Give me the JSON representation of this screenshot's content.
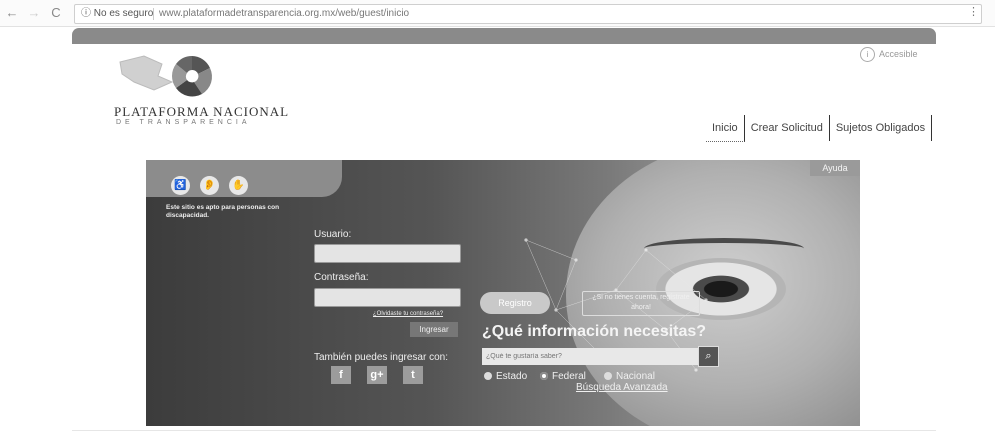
{
  "browser": {
    "back_glyph": "←",
    "forward_glyph": "→",
    "reload_glyph": "C",
    "security_label": "ⓘ No es seguro",
    "url": "www.plataformadetransparencia.org.mx/web/guest/inicio",
    "menu_glyph": "⋮"
  },
  "site": {
    "logo_title": "PLATAFORMA NACIONAL",
    "logo_subtitle": "DE TRANSPARENCIA",
    "accessibility_link": "Accesible",
    "accessibility_link_icon": "person-circle-icon",
    "nav": [
      {
        "label": "Inicio"
      },
      {
        "label": "Crear Solicitud"
      },
      {
        "label": "Sujetos Obligados"
      }
    ]
  },
  "hero": {
    "help_label": "Ayuda",
    "accessibility_icons": [
      "wheelchair-icon",
      "ear-icon",
      "sign-language-icon"
    ],
    "accessibility_glyphs": [
      "♿",
      "👂",
      "✋"
    ],
    "accessibility_text": "Este sitio es apto para personas con discapacidad.",
    "login": {
      "user_label": "Usuario:",
      "user_value": "",
      "password_label": "Contraseña:",
      "password_value": "",
      "forgot_label": "¿Olvidaste tu contraseña?",
      "submit_label": "Ingresar",
      "social_label": "También puedes ingresar con:",
      "social": [
        {
          "icon": "facebook-icon",
          "glyph": "f"
        },
        {
          "icon": "google-plus-icon",
          "glyph": "g+"
        },
        {
          "icon": "twitter-icon",
          "glyph": "t"
        }
      ]
    },
    "register_label": "Registro",
    "no_account_text": "¿Si no tienes cuenta, regístrate ahora!",
    "question": "¿Qué información necesitas?",
    "search_placeholder": "¿Qué te gustaría saber?",
    "search_icon": "search-icon",
    "scope_options": [
      {
        "label": "Estado",
        "selected": false
      },
      {
        "label": "Federal",
        "selected": true
      },
      {
        "label": "Nacional",
        "selected": false
      }
    ],
    "advanced_search_label": "Búsqueda Avanzada"
  }
}
